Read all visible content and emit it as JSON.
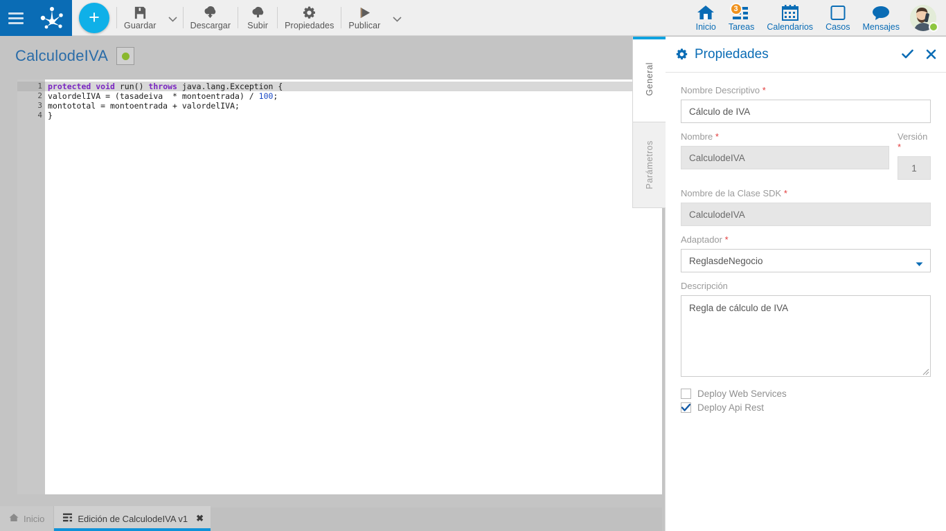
{
  "brand": {
    "menu_icon": "hamburger-menu-icon",
    "logo_icon": "bizagi-paw-logo-icon"
  },
  "toolbar": {
    "add_label": "+",
    "items": [
      {
        "label": "Guardar",
        "icon": "save-floppy-icon",
        "caret": true
      },
      {
        "label": "Descargar",
        "icon": "download-cloud-icon",
        "caret": false
      },
      {
        "label": "Subir",
        "icon": "upload-cloud-icon",
        "caret": false
      },
      {
        "label": "Propiedades",
        "icon": "gear-icon",
        "caret": false
      },
      {
        "label": "Publicar",
        "icon": "play-triangle-icon",
        "caret": true
      }
    ]
  },
  "topnav": {
    "items": [
      {
        "label": "Inicio",
        "icon": "home-icon",
        "badge": ""
      },
      {
        "label": "Tareas",
        "icon": "tasks-list-icon",
        "badge": "3"
      },
      {
        "label": "Calendarios",
        "icon": "calendar-icon",
        "badge": ""
      },
      {
        "label": "Casos",
        "icon": "case-square-icon",
        "badge": ""
      },
      {
        "label": "Mensajes",
        "icon": "speech-bubble-icon",
        "badge": ""
      }
    ],
    "avatar": {
      "name": "avatar",
      "status": "online"
    }
  },
  "editor": {
    "doc_title": "CalculodeIVA",
    "status_dot_color": "#8ab82e",
    "line_numbers": [
      "1",
      "2",
      "3",
      "4"
    ],
    "code_lines": [
      "protected void run() throws java.lang.Exception {",
      "valordelIVA = (tasadeiva  * montoentrada) / 100;",
      "montototal = montoentrada + valordelIVA;",
      "}"
    ]
  },
  "properties": {
    "title": "Propiedades",
    "gear_icon": "gear-icon",
    "accept_icon": "check-icon",
    "close_icon": "close-icon",
    "tabs": [
      {
        "label": "General",
        "active": true
      },
      {
        "label": "Parámetros",
        "active": false
      }
    ],
    "fields": {
      "nombre_descriptivo": {
        "label": "Nombre Descriptivo",
        "required": "*",
        "value": "Cálculo de IVA",
        "placeholder": ""
      },
      "nombre": {
        "label": "Nombre",
        "required": "*",
        "value": "CalculodeIVA",
        "placeholder": ""
      },
      "version": {
        "label": "Versión",
        "required": "*",
        "value": "1",
        "placeholder": ""
      },
      "clase_sdk": {
        "label": "Nombre de la Clase SDK",
        "required": "*",
        "value": "CalculodeIVA",
        "placeholder": ""
      },
      "adaptador": {
        "label": "Adaptador",
        "required": "*",
        "value": "ReglasdeNegocio",
        "placeholder": ""
      },
      "descripcion": {
        "label": "Descripción",
        "required": "",
        "value": "Regla de cálculo de IVA",
        "placeholder": ""
      }
    },
    "checkboxes": [
      {
        "label": "Deploy Web Services",
        "checked": false
      },
      {
        "label": "Deploy Api Rest",
        "checked": true
      }
    ]
  },
  "taskbar": {
    "tabs": [
      {
        "label": "Inicio",
        "icon": "home-icon",
        "active": false,
        "closable": false
      },
      {
        "label": "Edición de CalculodeIVA v1",
        "icon": "document-lines-icon",
        "active": true,
        "closable": true,
        "close_label": "✖"
      }
    ]
  },
  "colors": {
    "brand_blue": "#0a6cb5",
    "accent_cyan": "#0fb0e8",
    "badge_orange": "#f0921e",
    "status_green": "#8ab82e",
    "tab_underline": "#1092d8"
  }
}
